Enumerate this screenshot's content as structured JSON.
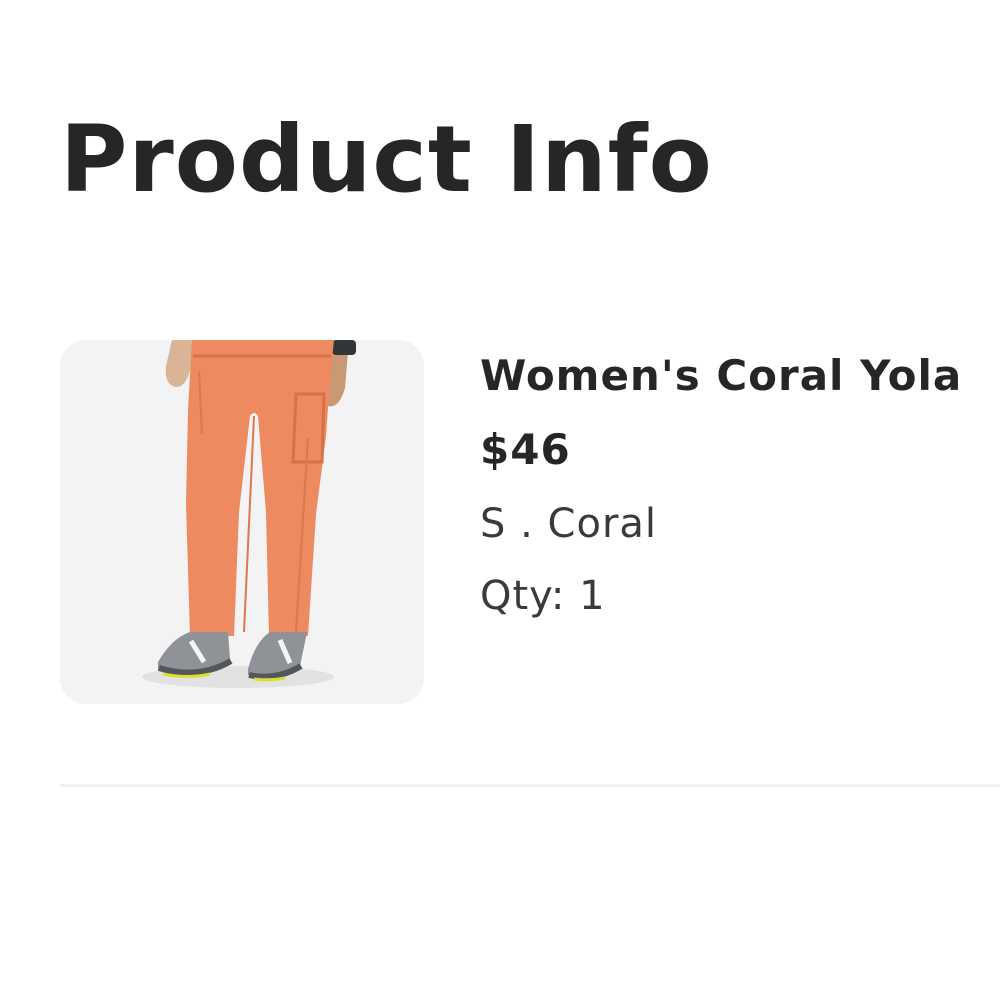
{
  "page": {
    "title": "Product Info"
  },
  "product": {
    "image_alt": "Women's Coral Yola scrub pants",
    "name": "Women's Coral Yola",
    "price": "$46",
    "variant": "S . Coral",
    "quantity": "Qty: 1"
  },
  "colors": {
    "text": "#262626",
    "image_background": "#f3f3f3",
    "divider": "#efefef",
    "product_color": "#ee8a60"
  }
}
